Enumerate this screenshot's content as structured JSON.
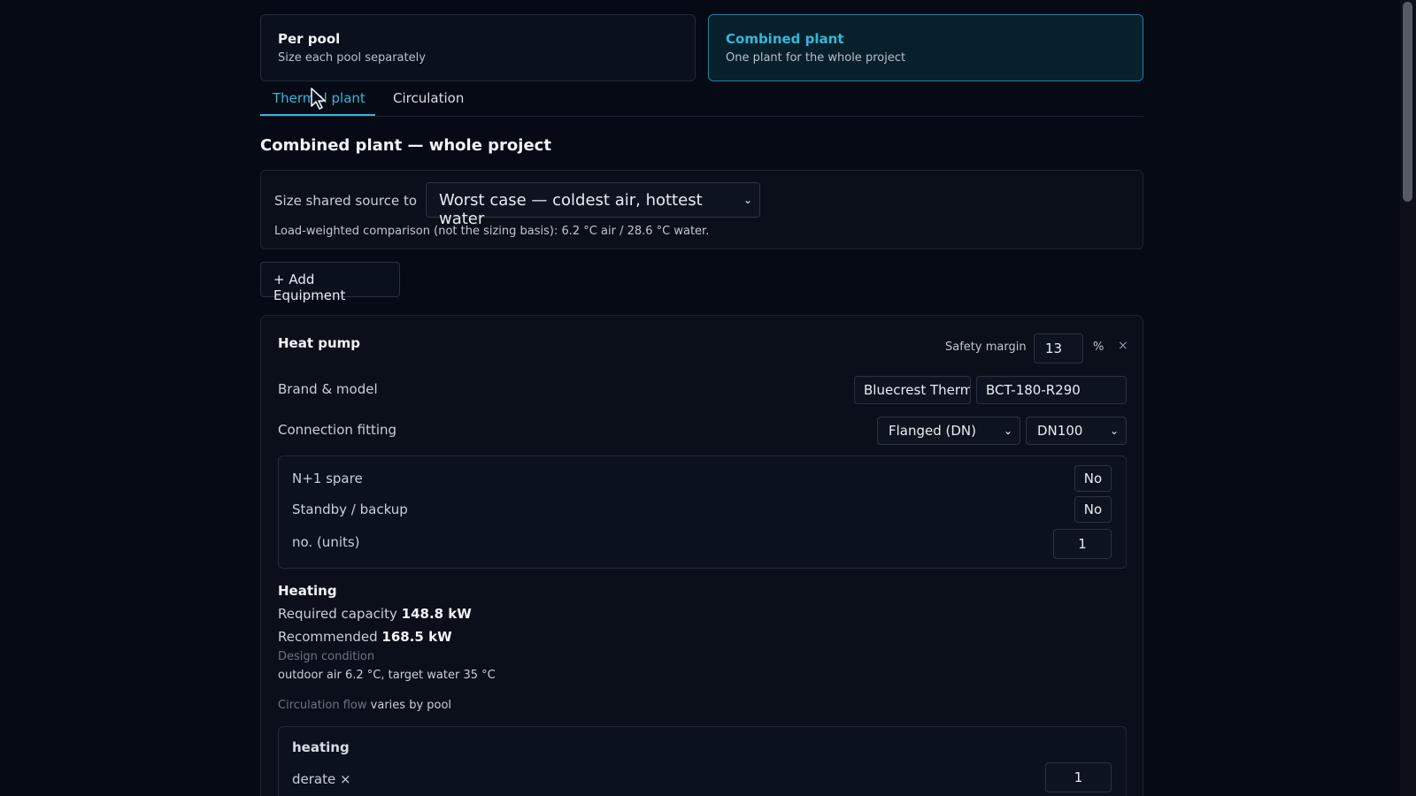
{
  "modes": {
    "per_pool": {
      "title": "Per pool",
      "subtitle": "Size each pool separately"
    },
    "combined": {
      "title": "Combined plant",
      "subtitle": "One plant for the whole project"
    }
  },
  "tabs": [
    {
      "label": "Thermal plant",
      "active": true
    },
    {
      "label": "Circulation",
      "active": false
    }
  ],
  "section_title": "Combined plant — whole project",
  "source": {
    "label": "Size shared source to",
    "selected": "Worst case — coldest air, hottest water",
    "note": "Load-weighted comparison (not the sizing basis): 6.2 °C air / 28.6 °C water."
  },
  "add_button": "+ Add Equipment",
  "equipment": {
    "title": "Heat pump",
    "safety_margin_label": "Safety margin",
    "safety_margin_value": "13",
    "percent": "%",
    "close": "×",
    "brand_label": "Brand & model",
    "brand_value": "Bluecrest Therm",
    "model_value": "BCT-180-R290",
    "fitting_label": "Connection fitting",
    "fitting_type": "Flanged (DN)",
    "fitting_size": "DN100",
    "spare_label": "N+1 spare",
    "spare_value": "No",
    "standby_label": "Standby / backup",
    "standby_value": "No",
    "units_label": "no. (units)",
    "units_value": "1",
    "heating": {
      "title": "Heating",
      "required_label": "Required capacity",
      "required_value": "148.8 kW",
      "recommended_label": "Recommended",
      "recommended_value": "168.5 kW",
      "design_label": "Design condition",
      "design_value": "outdoor air 6.2 °C, target water 35 °C",
      "flow_label": "Circulation flow",
      "flow_value": "varies by pool"
    },
    "heating_box": {
      "title": "heating",
      "derate_label": "derate ×",
      "derate_value": "1"
    }
  },
  "colors": {
    "accent": "#33b7d9",
    "background": "#050a14"
  }
}
